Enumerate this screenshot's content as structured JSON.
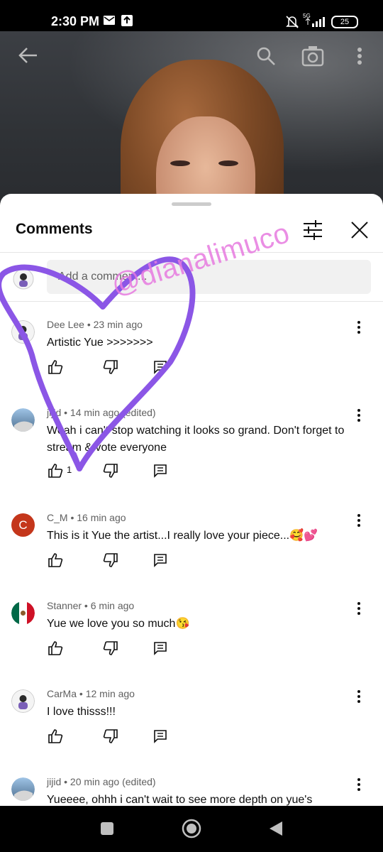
{
  "status_bar": {
    "time": "2:30 PM",
    "network": "5G",
    "battery": "25",
    "icons": [
      "mail-icon",
      "upload-icon",
      "mute-icon",
      "signal-icon"
    ]
  },
  "video_toolbar": {
    "icons": [
      "back-arrow-icon",
      "search-icon",
      "camera-icon",
      "more-vert-icon"
    ]
  },
  "comments_sheet": {
    "title": "Comments",
    "add_comment_placeholder": "Add a comment...",
    "icons": [
      "filter-icon",
      "close-icon"
    ]
  },
  "comments": [
    {
      "author": "Dee Lee",
      "time": "23 min ago",
      "edited": "",
      "text": "Artistic Yue >>>>>>>",
      "likes": "",
      "avatar": "logo-avatar"
    },
    {
      "author": "jijid",
      "time": "14 min ago",
      "edited": "(edited)",
      "text": "Woah i can't stop watching it looks so grand. Don't forget to stream & vote everyone",
      "likes": "1",
      "avatar": "photo-avatar"
    },
    {
      "author": "C_M",
      "time": "16 min ago",
      "edited": "",
      "text": "This is it Yue the artist...I really love your piece...🥰💕",
      "likes": "",
      "avatar": "letter-avatar",
      "avatar_letter": "C",
      "avatar_color": "#c4361b"
    },
    {
      "author": "Stanner",
      "time": "6 min ago",
      "edited": "",
      "text": "Yue we love you so much😘",
      "likes": "",
      "avatar": "flag-avatar"
    },
    {
      "author": "CarMa",
      "time": "12 min ago",
      "edited": "",
      "text": "I love thisss!!!",
      "likes": "",
      "avatar": "logo-avatar"
    },
    {
      "author": "jijid",
      "time": "20 min ago",
      "edited": "(edited)",
      "text": "Yueeee, ohhh i can't wait to see more depth on yue's",
      "likes": "",
      "avatar": "photo-avatar"
    }
  ],
  "overlay": {
    "watermark": "@dianalimuco",
    "heart_color": "#8b56e6",
    "watermark_color": "#e77be0"
  },
  "nav_bar": {
    "icons": [
      "recents-square-icon",
      "home-circle-icon",
      "back-triangle-icon"
    ]
  }
}
